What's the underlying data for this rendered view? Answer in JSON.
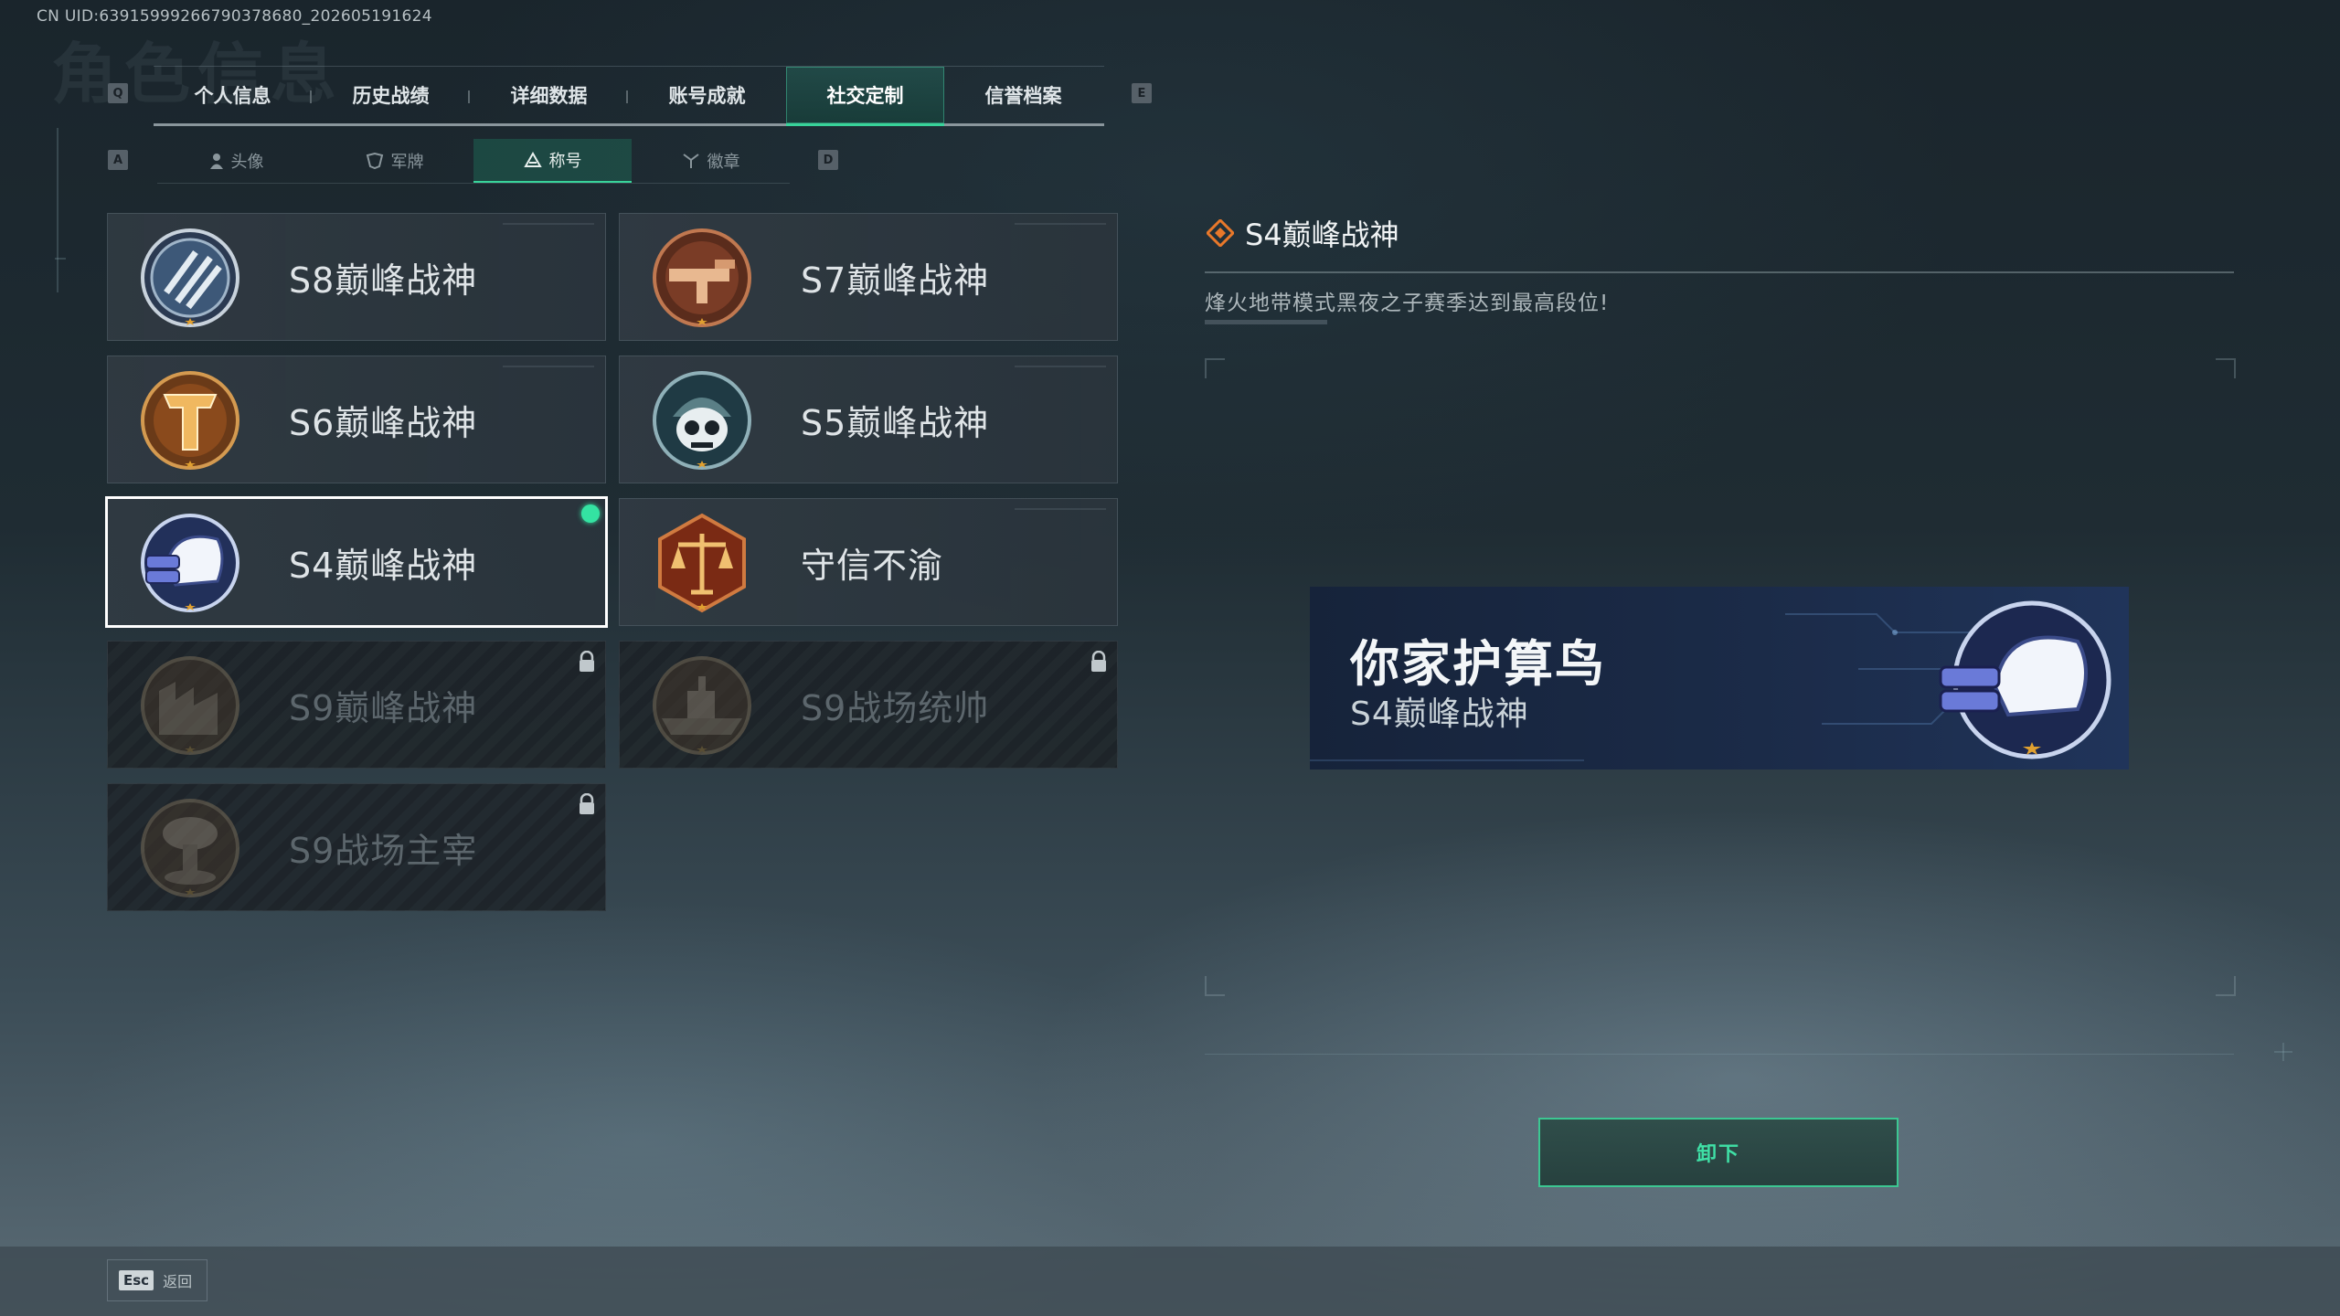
{
  "uid_text": "CN UID:639159992667903786​80_202605191624",
  "ghost_title": "角色信息",
  "main_tabs": {
    "left_key": "Q",
    "right_key": "E",
    "items": [
      {
        "label": "个人信息"
      },
      {
        "label": "历史战绩"
      },
      {
        "label": "详细数据"
      },
      {
        "label": "账号成就"
      },
      {
        "label": "社交定制",
        "active": true
      },
      {
        "label": "信誉档案"
      }
    ]
  },
  "sub_tabs": {
    "left_key": "A",
    "right_key": "D",
    "items": [
      {
        "label": "头像",
        "icon": "person-icon"
      },
      {
        "label": "军牌",
        "icon": "dogtag-icon"
      },
      {
        "label": "称号",
        "icon": "title-icon",
        "active": true
      },
      {
        "label": "徽章",
        "icon": "emblem-icon"
      }
    ]
  },
  "titles": [
    {
      "name": "S8巅峰战神",
      "badge": "striped-shield-badge-icon",
      "state": "unlocked"
    },
    {
      "name": "S7巅峰战神",
      "badge": "weapon-badge-icon",
      "state": "unlocked"
    },
    {
      "name": "S6巅峰战神",
      "badge": "golden-t-badge-icon",
      "state": "unlocked"
    },
    {
      "name": "S5巅峰战神",
      "badge": "skull-helmet-badge-icon",
      "state": "unlocked"
    },
    {
      "name": "S4巅峰战神",
      "badge": "nightvision-helmet-badge-icon",
      "state": "equipped"
    },
    {
      "name": "守信不渝",
      "badge": "scales-badge-icon",
      "state": "unlocked"
    },
    {
      "name": "S9巅峰战神",
      "badge": "fortress-badge-icon",
      "state": "locked"
    },
    {
      "name": "S9战场统帅",
      "badge": "warship-badge-icon",
      "state": "locked"
    },
    {
      "name": "S9战场主宰",
      "badge": "mushroom-cloud-badge-icon",
      "state": "locked"
    }
  ],
  "detail": {
    "title": "S4巅峰战神",
    "description": "烽火地带模式黑夜之子赛季达到最高段位!"
  },
  "nameplate": {
    "player_name": "你家护算鸟",
    "title": "S4巅峰战神"
  },
  "unequip_label": "卸下",
  "back": {
    "key": "Esc",
    "label": "返回"
  },
  "colors": {
    "accent": "#38d39a",
    "badge_gold": "#e0a030",
    "badge_bronze": "#8a4a2a"
  }
}
